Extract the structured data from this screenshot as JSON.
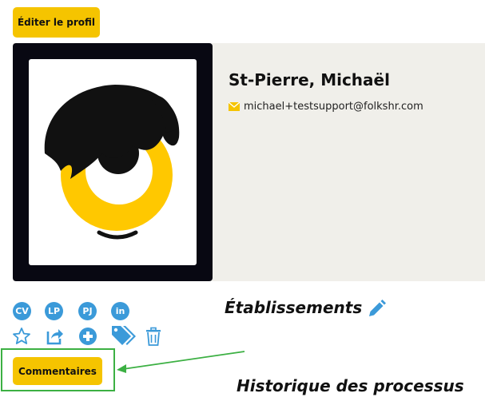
{
  "header": {
    "edit_profile_label": "Éditer le profil"
  },
  "profile": {
    "name": "St-Pierre, Michaël",
    "email": "michael+testsupport@folkshr.com"
  },
  "badges": {
    "cv": "CV",
    "lp": "LP",
    "pj": "PJ",
    "linkedin": "in"
  },
  "actions": [
    "star-icon",
    "share-icon",
    "add-icon",
    "tag-icon",
    "trash-icon"
  ],
  "sections": {
    "establishments": "Établissements",
    "process_history": "Historique des processus"
  },
  "comments_label": "Commentaires",
  "colors": {
    "accent_yellow": "#f5c400",
    "icon_blue": "#3b9ad9",
    "annotation_green": "#3cb043",
    "photo_frame": "#080812"
  }
}
